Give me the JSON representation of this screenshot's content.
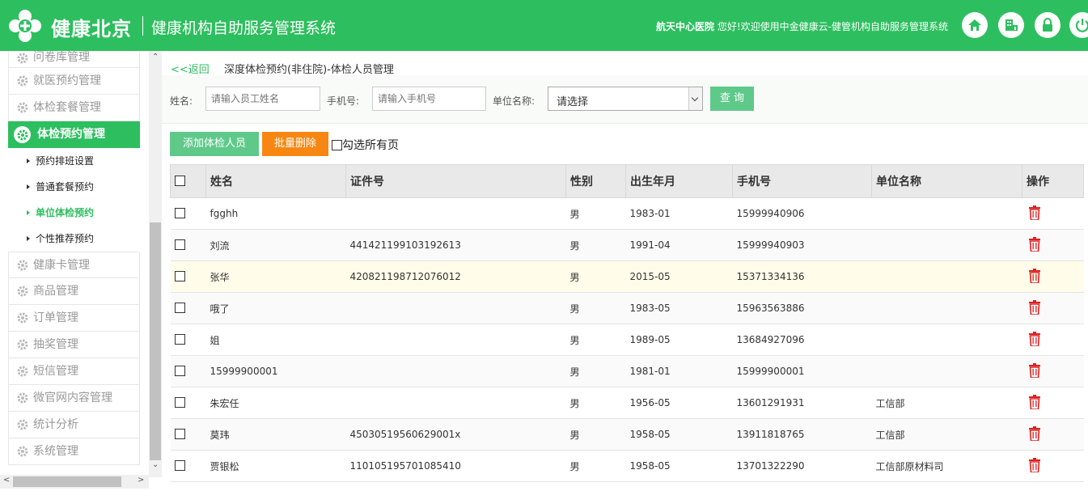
{
  "header": {
    "brand": "健康北京",
    "system_name": "健康机构自助服务管理系统",
    "hospital": "航天中心医院",
    "greeting": "您好!欢迎使用中金健康云-健管机构自助服务管理系统",
    "icons": [
      "home-icon",
      "hospital-icon",
      "lock-icon",
      "power-icon"
    ]
  },
  "sidebar": {
    "items_top": [
      {
        "label": "问卷库管理"
      },
      {
        "label": "就医预约管理"
      },
      {
        "label": "体检套餐管理"
      }
    ],
    "active_item": {
      "label": "体检预约管理"
    },
    "sub_items": [
      {
        "label": "预约排班设置"
      },
      {
        "label": "普通套餐预约"
      },
      {
        "label": "单位体检预约",
        "active": true
      },
      {
        "label": "个性推荐预约"
      }
    ],
    "items_bottom": [
      {
        "label": "健康卡管理"
      },
      {
        "label": "商品管理"
      },
      {
        "label": "订单管理"
      },
      {
        "label": "抽奖管理"
      },
      {
        "label": "短信管理"
      },
      {
        "label": "微官网内容管理"
      },
      {
        "label": "统计分析"
      },
      {
        "label": "系统管理"
      }
    ]
  },
  "main": {
    "back_label": "<<返回",
    "page_title": "深度体检预约(非住院)-体检人员管理",
    "search": {
      "name_label": "姓名:",
      "name_placeholder": "请输入员工姓名",
      "phone_label": "手机号:",
      "phone_placeholder": "请输入手机号",
      "unit_label": "单位名称:",
      "unit_value": "请选择",
      "query_label": "查 询"
    },
    "actions": {
      "add_label": "添加体检人员",
      "batch_delete_label": "批量删除",
      "select_all_pages_label": "勾选所有页"
    },
    "table": {
      "columns": [
        "姓名",
        "证件号",
        "性别",
        "出生年月",
        "手机号",
        "单位名称",
        "操作"
      ],
      "rows": [
        {
          "name": "fgghh",
          "id": "",
          "gender": "男",
          "birth": "1983-01",
          "phone": "15999940906",
          "unit": ""
        },
        {
          "name": "刘流",
          "id": "441421199103192613",
          "gender": "男",
          "birth": "1991-04",
          "phone": "15999940903",
          "unit": ""
        },
        {
          "name": "张华",
          "id": "420821198712076012",
          "gender": "男",
          "birth": "2015-05",
          "phone": "15371334136",
          "unit": ""
        },
        {
          "name": "哦了",
          "id": "",
          "gender": "男",
          "birth": "1983-05",
          "phone": "15963563886",
          "unit": ""
        },
        {
          "name": "姐",
          "id": "",
          "gender": "男",
          "birth": "1989-05",
          "phone": "13684927096",
          "unit": ""
        },
        {
          "name": "15999900001",
          "id": "",
          "gender": "男",
          "birth": "1981-01",
          "phone": "15999900001",
          "unit": ""
        },
        {
          "name": "朱宏任",
          "id": "",
          "gender": "男",
          "birth": "1956-05",
          "phone": "13601291931",
          "unit": "工信部"
        },
        {
          "name": "莫玮",
          "id": "45030519560629001x",
          "gender": "男",
          "birth": "1958-05",
          "phone": "13911818765",
          "unit": "工信部"
        },
        {
          "name": "贾银松",
          "id": "110105195701085410",
          "gender": "男",
          "birth": "1958-05",
          "phone": "13701322290",
          "unit": "工信部原材料司"
        }
      ]
    }
  },
  "colors": {
    "brand_green": "#2dbf5f",
    "button_green": "#5fc98a",
    "orange": "#f78712",
    "delete_red": "#e02020",
    "highlight_row": "#fffdea"
  }
}
